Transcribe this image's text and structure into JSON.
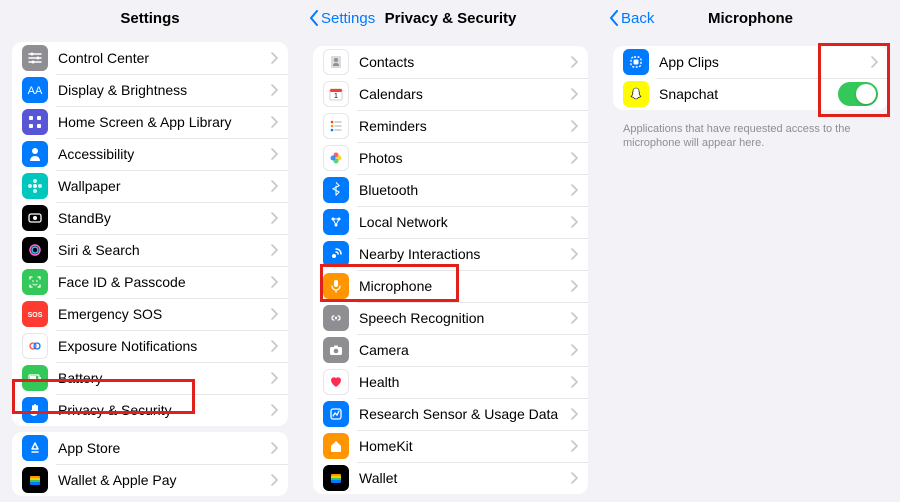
{
  "pane1": {
    "title": "Settings",
    "listA": [
      {
        "label": "Control Center",
        "icon": "sliders-icon",
        "bg": "bg-gray"
      },
      {
        "label": "Display & Brightness",
        "icon": "sun-icon",
        "bg": "bg-blue"
      },
      {
        "label": "Home Screen & App Library",
        "icon": "grid-icon",
        "bg": "bg-purple"
      },
      {
        "label": "Accessibility",
        "icon": "person-icon",
        "bg": "bg-blue"
      },
      {
        "label": "Wallpaper",
        "icon": "flower-icon",
        "bg": "bg-teal"
      },
      {
        "label": "StandBy",
        "icon": "standby-icon",
        "bg": "bg-black"
      },
      {
        "label": "Siri & Search",
        "icon": "siri-icon",
        "bg": "bg-black"
      },
      {
        "label": "Face ID & Passcode",
        "icon": "faceid-icon",
        "bg": "bg-green"
      },
      {
        "label": "Emergency SOS",
        "icon": "sos-icon",
        "bg": "bg-red"
      },
      {
        "label": "Exposure Notifications",
        "icon": "exposure-icon",
        "bg": "bg-white"
      },
      {
        "label": "Battery",
        "icon": "battery-icon",
        "bg": "bg-green"
      },
      {
        "label": "Privacy & Security",
        "icon": "hand-icon",
        "bg": "bg-blue"
      }
    ],
    "listB": [
      {
        "label": "App Store",
        "icon": "appstore-icon",
        "bg": "bg-blue"
      },
      {
        "label": "Wallet & Apple Pay",
        "icon": "wallet-icon",
        "bg": "bg-black"
      }
    ]
  },
  "pane2": {
    "back": "Settings",
    "title": "Privacy & Security",
    "list": [
      {
        "label": "Contacts",
        "icon": "contacts-icon",
        "bg": "bg-white"
      },
      {
        "label": "Calendars",
        "icon": "calendar-icon",
        "bg": "bg-white"
      },
      {
        "label": "Reminders",
        "icon": "reminders-icon",
        "bg": "bg-white"
      },
      {
        "label": "Photos",
        "icon": "photos-icon",
        "bg": "bg-white"
      },
      {
        "label": "Bluetooth",
        "icon": "bluetooth-icon",
        "bg": "bg-blue"
      },
      {
        "label": "Local Network",
        "icon": "network-icon",
        "bg": "bg-blue"
      },
      {
        "label": "Nearby Interactions",
        "icon": "nearby-icon",
        "bg": "bg-blue"
      },
      {
        "label": "Microphone",
        "icon": "mic-icon",
        "bg": "bg-orange"
      },
      {
        "label": "Speech Recognition",
        "icon": "speech-icon",
        "bg": "bg-gray"
      },
      {
        "label": "Camera",
        "icon": "camera-icon",
        "bg": "bg-gray"
      },
      {
        "label": "Health",
        "icon": "heart-icon",
        "bg": "bg-white"
      },
      {
        "label": "Research Sensor & Usage Data",
        "icon": "research-icon",
        "bg": "bg-blue"
      },
      {
        "label": "HomeKit",
        "icon": "home-icon",
        "bg": "bg-orange"
      },
      {
        "label": "Wallet",
        "icon": "wallet2-icon",
        "bg": "bg-black"
      }
    ]
  },
  "pane3": {
    "back": "Back",
    "title": "Microphone",
    "list": [
      {
        "label": "App Clips",
        "icon": "appclips-icon",
        "bg": "bg-blue",
        "accessory": "chevron"
      },
      {
        "label": "Snapchat",
        "icon": "snapchat-icon",
        "bg": "bg-yellow",
        "accessory": "toggle"
      }
    ],
    "footnote": "Applications that have requested access to the microphone will appear here."
  }
}
